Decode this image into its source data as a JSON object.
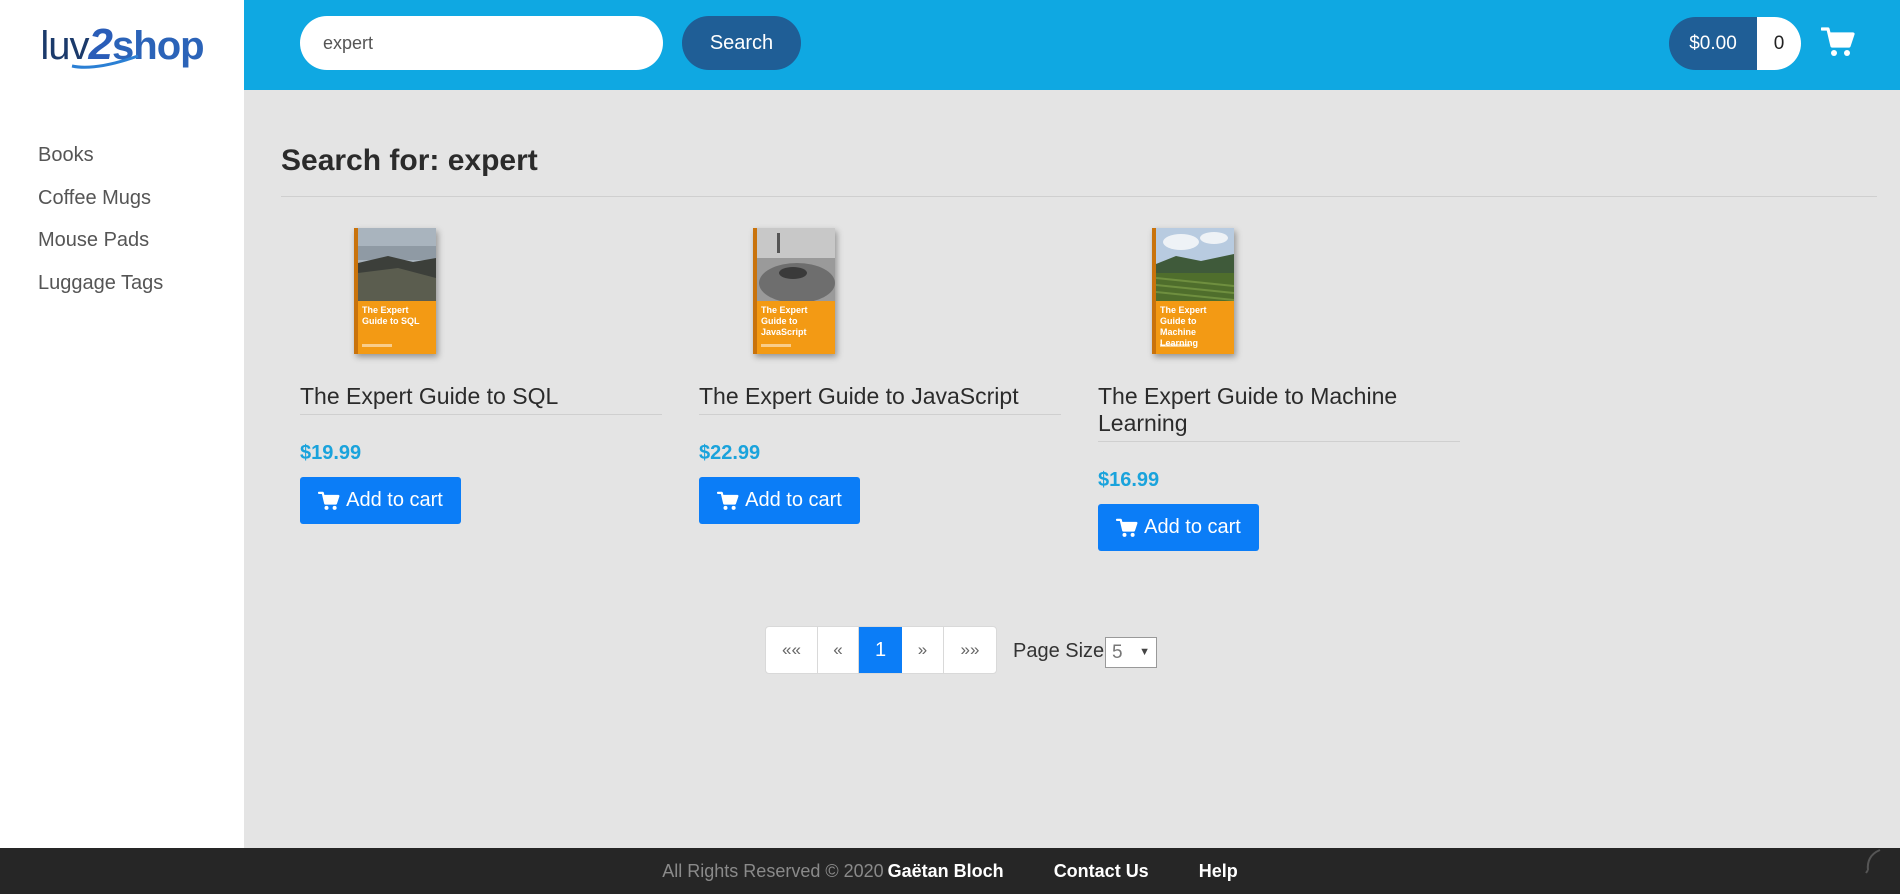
{
  "brand": {
    "logo_text": "luv2shop",
    "logo_part1": "luv",
    "logo_part2": "2",
    "logo_part3": "shop"
  },
  "header": {
    "search_value": "expert",
    "search_button": "Search",
    "cart_total": "$0.00",
    "cart_quantity": "0",
    "cart_icon": "shopping-cart-icon"
  },
  "sidebar": {
    "items": [
      {
        "label": "Books"
      },
      {
        "label": "Coffee Mugs"
      },
      {
        "label": "Mouse Pads"
      },
      {
        "label": "Luggage Tags"
      }
    ]
  },
  "main": {
    "title": "Search for: expert",
    "products": [
      {
        "name": "The Expert Guide to SQL",
        "price": "$19.99",
        "cover_text": "The Expert Guide to SQL",
        "button": "Add to cart"
      },
      {
        "name": "The Expert Guide to JavaScript",
        "price": "$22.99",
        "cover_text": "The Expert Guide to JavaScript",
        "button": "Add to cart"
      },
      {
        "name": "The Expert Guide to Machine Learning",
        "price": "$16.99",
        "cover_text": "The Expert Guide to Machine Learning",
        "button": "Add to cart"
      }
    ]
  },
  "pagination": {
    "first": "««",
    "prev": "«",
    "current": "1",
    "next": "»",
    "last": "»»",
    "page_size_label": "Page Size",
    "page_size_value": "5"
  },
  "footer": {
    "rights": "All Rights Reserved © 2020",
    "author": "Gaëtan Bloch",
    "contact": "Contact Us",
    "help": "Help"
  },
  "colors": {
    "topbar": "#0fa8e2",
    "dark_button": "#1f5e96",
    "primary_button": "#0b7df7",
    "price": "#1aa3dc",
    "footer": "#262626"
  }
}
